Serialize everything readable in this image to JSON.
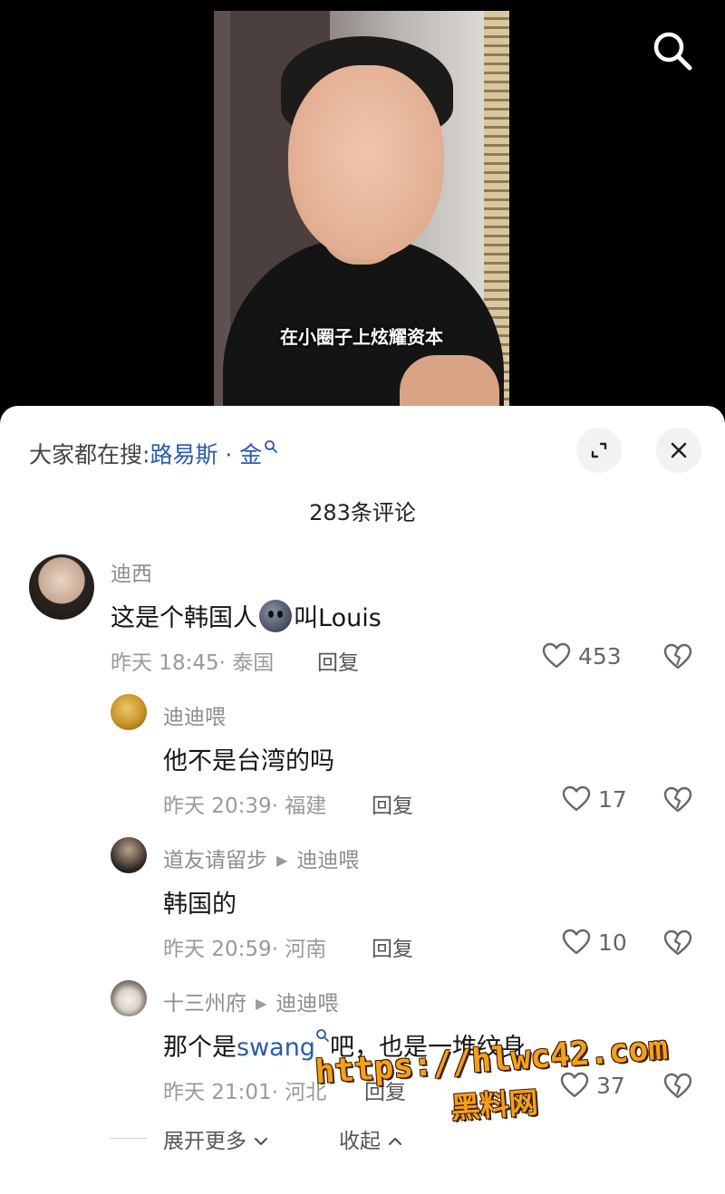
{
  "video": {
    "caption": "在小圈子上炫耀资本",
    "search_icon": "search-icon"
  },
  "sheet": {
    "search_prefix": "大家都在搜:",
    "search_query": "路易斯 · 金",
    "expand_icon": "expand-icon",
    "close_icon": "close-icon",
    "comment_count": "283条评论"
  },
  "comments": [
    {
      "user": "迪西",
      "text_before": "这是个韩国人",
      "emoji": "blob-face-emoji",
      "text_after": "叫Louis",
      "time": "昨天 18:45",
      "location": "· 泰国",
      "reply_label": "回复",
      "likes": "453"
    }
  ],
  "replies": [
    {
      "user": "迪迪喂",
      "text": "他不是台湾的吗",
      "time": "昨天 20:39",
      "location": "· 福建",
      "reply_label": "回复",
      "likes": "17"
    },
    {
      "user": "道友请留步",
      "reply_to": "迪迪喂",
      "text": "韩国的",
      "time": "昨天 20:59",
      "location": "· 河南",
      "reply_label": "回复",
      "likes": "10"
    },
    {
      "user": "十三州府",
      "reply_to": "迪迪喂",
      "text_before": "那个是",
      "link_word": "swang",
      "text_after": "吧，也是一堆纹身",
      "time": "昨天 21:01",
      "location": "· 河北",
      "reply_label": "回复",
      "likes": "37"
    }
  ],
  "footer": {
    "expand_more": "展开更多",
    "collapse": "收起"
  },
  "watermark": {
    "url": "https://hlwc42.com",
    "name": "黑料网"
  },
  "colors": {
    "link_blue": "#2b5aa8",
    "watermark_orange": "#f5a018"
  }
}
